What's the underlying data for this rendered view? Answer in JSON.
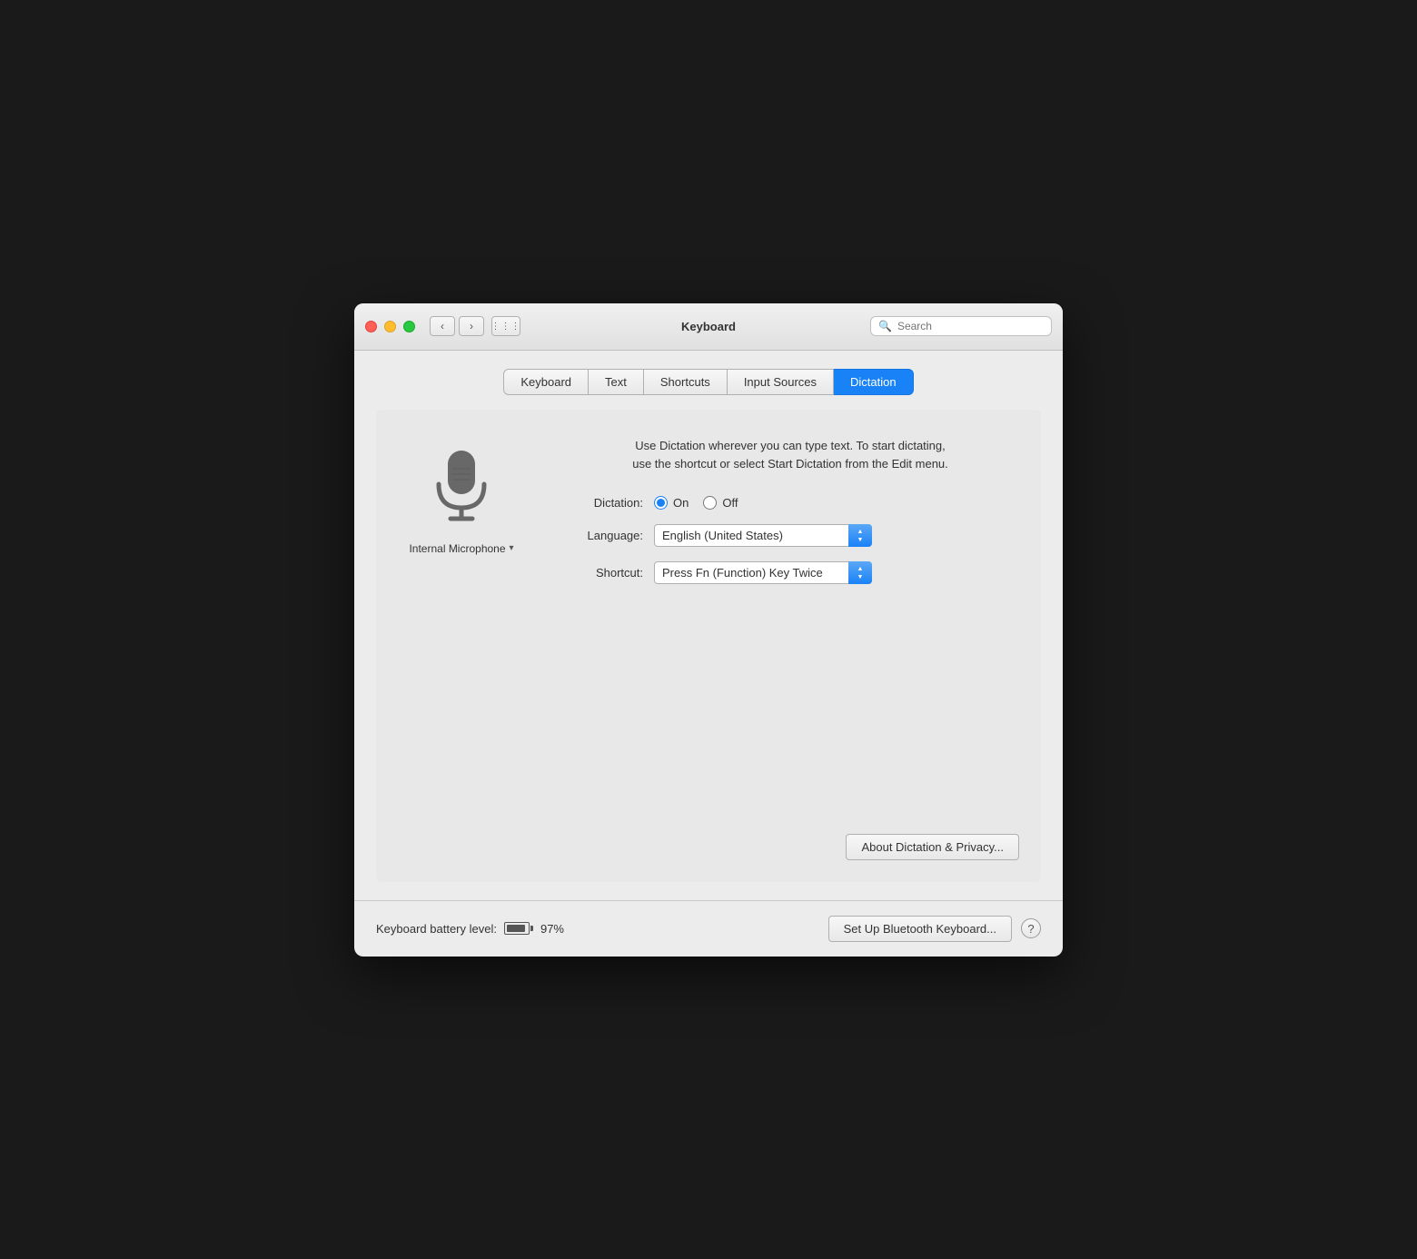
{
  "window": {
    "title": "Keyboard"
  },
  "titlebar": {
    "search_placeholder": "Search"
  },
  "tabs": [
    {
      "id": "keyboard",
      "label": "Keyboard",
      "active": false
    },
    {
      "id": "text",
      "label": "Text",
      "active": false
    },
    {
      "id": "shortcuts",
      "label": "Shortcuts",
      "active": false
    },
    {
      "id": "input-sources",
      "label": "Input Sources",
      "active": false
    },
    {
      "id": "dictation",
      "label": "Dictation",
      "active": true
    }
  ],
  "dictation": {
    "description_line1": "Use Dictation wherever you can type text. To start dictating,",
    "description_line2": "use the shortcut or select Start Dictation from the Edit menu.",
    "dictation_label": "Dictation:",
    "on_label": "On",
    "off_label": "Off",
    "language_label": "Language:",
    "language_value": "English (United States)",
    "shortcut_label": "Shortcut:",
    "shortcut_value": "Press Fn (Function) Key Twice",
    "about_btn_label": "About Dictation & Privacy...",
    "mic_label": "Internal Microphone",
    "mic_dropdown": "▾"
  },
  "footer": {
    "battery_label": "Keyboard battery level:",
    "battery_percent": "97%",
    "bluetooth_btn_label": "Set Up Bluetooth Keyboard...",
    "help_label": "?"
  },
  "icons": {
    "back": "‹",
    "forward": "›",
    "grid": "⋮⋮⋮",
    "search": "🔍"
  }
}
